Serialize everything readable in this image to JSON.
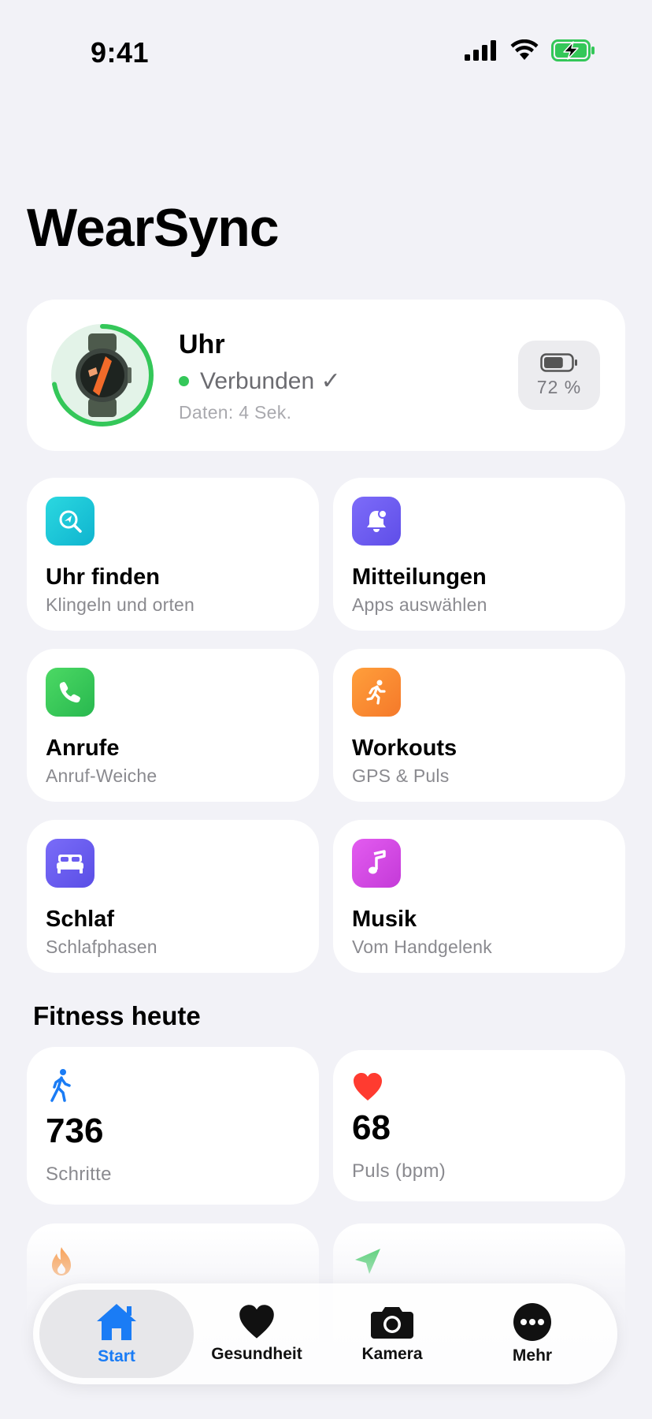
{
  "status_bar": {
    "time": "9:41"
  },
  "app": {
    "title": "WearSync"
  },
  "device": {
    "name": "Uhr",
    "status": "Verbunden ✓",
    "data_age": "Daten: 4 Sek.",
    "battery": "72 %",
    "battery_level": 0.72
  },
  "tiles": [
    {
      "title": "Uhr finden",
      "subtitle": "Klingeln und orten",
      "icon": "location-search-icon",
      "color": "#12c4d6"
    },
    {
      "title": "Mitteilungen",
      "subtitle": "Apps auswählen",
      "icon": "bell-icon",
      "color": "#6e5cf6"
    },
    {
      "title": "Anrufe",
      "subtitle": "Anruf-Weiche",
      "icon": "phone-icon",
      "color": "#30c45a"
    },
    {
      "title": "Workouts",
      "subtitle": "GPS & Puls",
      "icon": "running-icon",
      "color": "#fa8c2d"
    },
    {
      "title": "Schlaf",
      "subtitle": "Schlafphasen",
      "icon": "bed-icon",
      "color": "#6a5cf0"
    },
    {
      "title": "Musik",
      "subtitle": "Vom Handgelenk",
      "icon": "music-note-icon",
      "color": "#d94ae0"
    }
  ],
  "fitness": {
    "title": "Fitness heute",
    "metrics": [
      {
        "value": "736",
        "label": "Schritte",
        "icon": "walking-icon",
        "color": "#1a7cf5"
      },
      {
        "value": "68",
        "label": "Puls (bpm)",
        "icon": "heart-icon",
        "color": "#ff3b30"
      },
      {
        "value": "",
        "label": "",
        "icon": "flame-icon",
        "color": "#fa8c2d"
      },
      {
        "value": "",
        "label": "",
        "icon": "location-arrow-icon",
        "color": "#34c759"
      }
    ]
  },
  "tabbar": {
    "tabs": [
      {
        "label": "Start",
        "icon": "house-icon",
        "active": true
      },
      {
        "label": "Gesundheit",
        "icon": "heart-icon"
      },
      {
        "label": "Kamera",
        "icon": "camera-icon"
      },
      {
        "label": "Mehr",
        "icon": "more-icon"
      }
    ]
  },
  "colors": {
    "accent": "#1a7cf5",
    "connected": "#34c759",
    "background": "#f2f2f7"
  }
}
